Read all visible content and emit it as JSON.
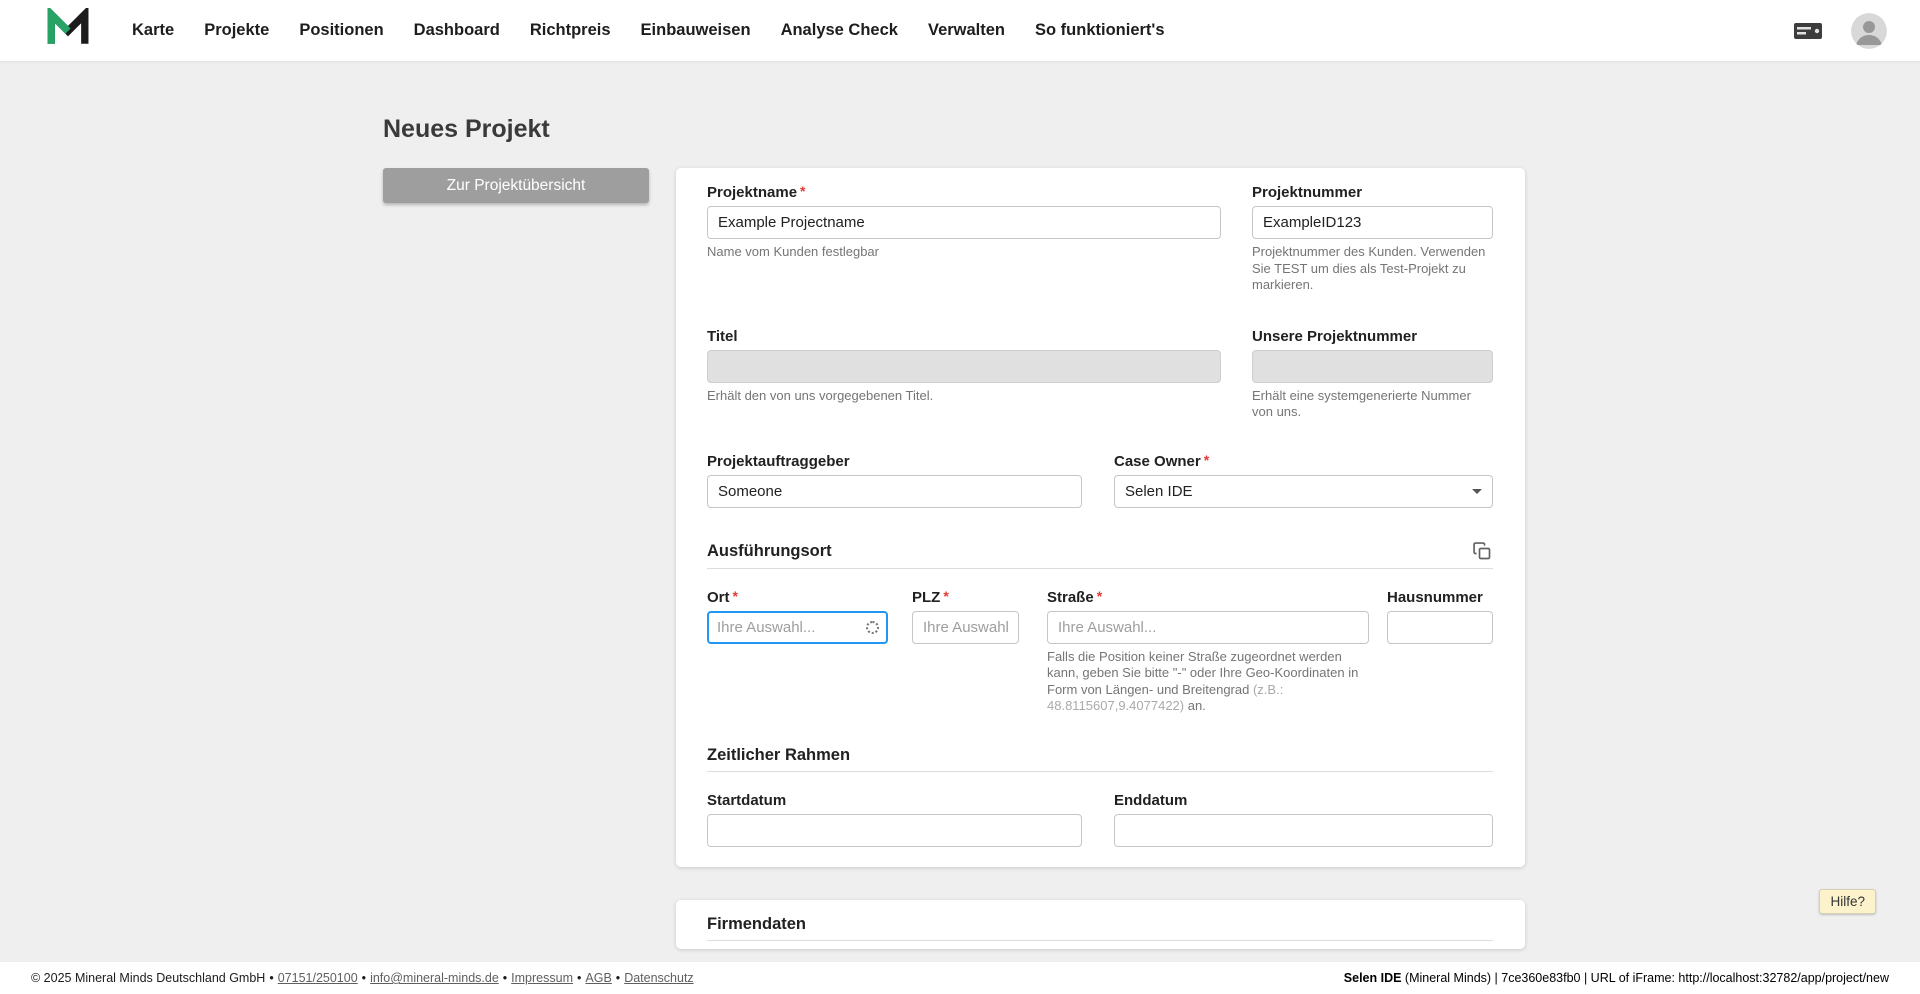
{
  "colors": {
    "accent_blue": "#2196f3",
    "brand_green": "#27a366",
    "required_red": "#e53935",
    "button_gray": "#9e9e9e",
    "help_yellow": "#fcf3cd",
    "page_background": "#efefef"
  },
  "ui": {
    "required_marker": "*"
  },
  "navbar": {
    "items": [
      {
        "label": "Karte"
      },
      {
        "label": "Projekte"
      },
      {
        "label": "Positionen"
      },
      {
        "label": "Dashboard"
      },
      {
        "label": "Richtpreis"
      },
      {
        "label": "Einbauweisen"
      },
      {
        "label": "Analyse Check"
      },
      {
        "label": "Verwalten"
      },
      {
        "label": "So funktioniert's"
      }
    ],
    "icons": {
      "right_device": "server-icon",
      "right_user": "user-avatar-icon"
    }
  },
  "page": {
    "title": "Neues Projekt",
    "back_button": "Zur Projektübersicht"
  },
  "form": {
    "projektname": {
      "label": "Projektname",
      "value": "Example Projectname",
      "helper": "Name vom Kunden festlegbar"
    },
    "projektnummer": {
      "label": "Projektnummer",
      "value": "ExampleID123",
      "helper": "Projektnummer des Kunden. Verwenden Sie TEST um dies als Test-Projekt zu markieren."
    },
    "titel": {
      "label": "Titel",
      "helper": "Erhält den von uns vorgegebenen Titel."
    },
    "unsere_projektnummer": {
      "label": "Unsere Projektnummer",
      "helper": "Erhält eine systemgenerierte Nummer von uns."
    },
    "projektauftraggeber": {
      "label": "Projektauftraggeber",
      "value": "Someone"
    },
    "case_owner": {
      "label": "Case Owner",
      "value": "Selen IDE"
    },
    "sections": {
      "ausfuehrungsort": "Ausführungsort",
      "zeitlicher_rahmen": "Zeitlicher Rahmen",
      "firmendaten": "Firmendaten"
    },
    "ort": {
      "label": "Ort",
      "placeholder": "Ihre Auswahl..."
    },
    "plz": {
      "label": "PLZ",
      "placeholder": "Ihre Auswahl."
    },
    "strasse": {
      "label": "Straße",
      "placeholder": "Ihre Auswahl...",
      "helper_main": "Falls die Position keiner Straße zugeordnet werden kann, geben Sie bitte \"-\" oder Ihre Geo-Koordinaten in Form von Längen- und Breitengrad ",
      "helper_example": "(z.B.: 48.8115607,9.4077422)",
      "helper_suffix": " an."
    },
    "hausnummer": {
      "label": "Hausnummer"
    },
    "startdatum": {
      "label": "Startdatum"
    },
    "enddatum": {
      "label": "Enddatum"
    }
  },
  "help_button": "Hilfe?",
  "footer": {
    "separator": "•",
    "copyright": "© 2025 Mineral Minds Deutschland GmbH",
    "phone": "07151/250100",
    "email": "info@mineral-minds.de",
    "link_impressum": "Impressum",
    "link_agb": "AGB",
    "link_datenschutz": "Datenschutz",
    "right_bold": "Selen IDE",
    "right_rest": " (Mineral Minds) | 7ce360e83fb0 | URL of iFrame: http://localhost:32782/app/project/new"
  }
}
